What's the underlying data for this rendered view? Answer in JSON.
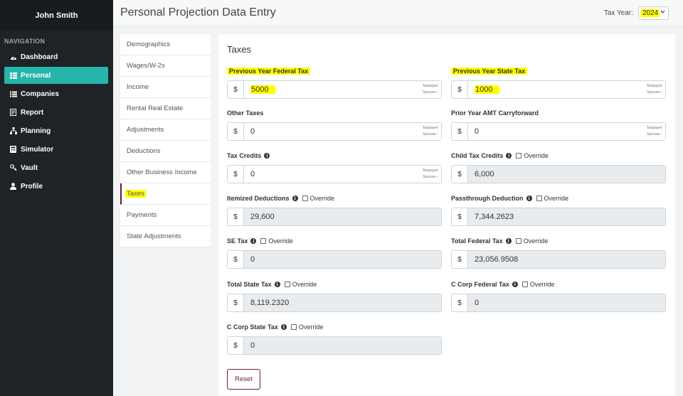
{
  "user": {
    "name": "John Smith"
  },
  "navigation": {
    "heading": "NAVIGATION",
    "items": [
      {
        "label": "Dashboard",
        "icon": "dashboard-icon"
      },
      {
        "label": "Personal",
        "icon": "table-icon",
        "active": true
      },
      {
        "label": "Companies",
        "icon": "list-icon"
      },
      {
        "label": "Report",
        "icon": "file-icon"
      },
      {
        "label": "Planning",
        "icon": "sitemap-icon"
      },
      {
        "label": "Simulator",
        "icon": "calculator-icon"
      },
      {
        "label": "Vault",
        "icon": "key-icon"
      },
      {
        "label": "Profile",
        "icon": "user-icon"
      }
    ]
  },
  "header": {
    "title": "Personal Projection Data Entry",
    "tax_year_label": "Tax Year:",
    "tax_year_value": "2024"
  },
  "subnav": [
    "Demographics",
    "Wages/W-2s",
    "Income",
    "Rental Real Estate",
    "Adjustments",
    "Deductions",
    "Other Business Income",
    "Taxes",
    "Payments",
    "State Adjustments"
  ],
  "subnav_active": "Taxes",
  "card": {
    "title": "Taxes",
    "currency_symbol": "$",
    "taxpayer_label": "Taxpayer",
    "spouse_label": "Spouse ›",
    "override_label": "Override",
    "info_glyph": "i",
    "fields": {
      "prev_federal_tax": {
        "label": "Previous Year Federal Tax",
        "value": "5000"
      },
      "prev_state_tax": {
        "label": "Previous Year State Tax",
        "value": "1000"
      },
      "other_taxes": {
        "label": "Other Taxes",
        "value": "0"
      },
      "prior_amt": {
        "label": "Prior Year AMT Carryforward",
        "value": "0"
      },
      "tax_credits": {
        "label": "Tax Credits",
        "value": "0"
      },
      "child_tax_credits": {
        "label": "Child Tax Credits",
        "value": "6,000"
      },
      "itemized_deductions": {
        "label": "Itemized Deductions",
        "value": "29,600"
      },
      "passthrough_deduction": {
        "label": "Passthrough Deduction",
        "value": "7,344.2623"
      },
      "se_tax": {
        "label": "SE Tax",
        "value": "0"
      },
      "total_federal_tax": {
        "label": "Total Federal Tax",
        "value": "23,056.9508"
      },
      "total_state_tax": {
        "label": "Total State Tax",
        "value": "8,119.2320"
      },
      "c_corp_federal_tax": {
        "label": "C Corp Federal Tax",
        "value": "0"
      },
      "c_corp_state_tax": {
        "label": "C Corp State Tax",
        "value": "0"
      }
    },
    "reset_label": "Reset"
  },
  "colors": {
    "sidebar_bg": "#1f2327",
    "active_nav": "#26b5aa",
    "brand_accent": "#6b1a45",
    "highlight": "#ffff00"
  }
}
